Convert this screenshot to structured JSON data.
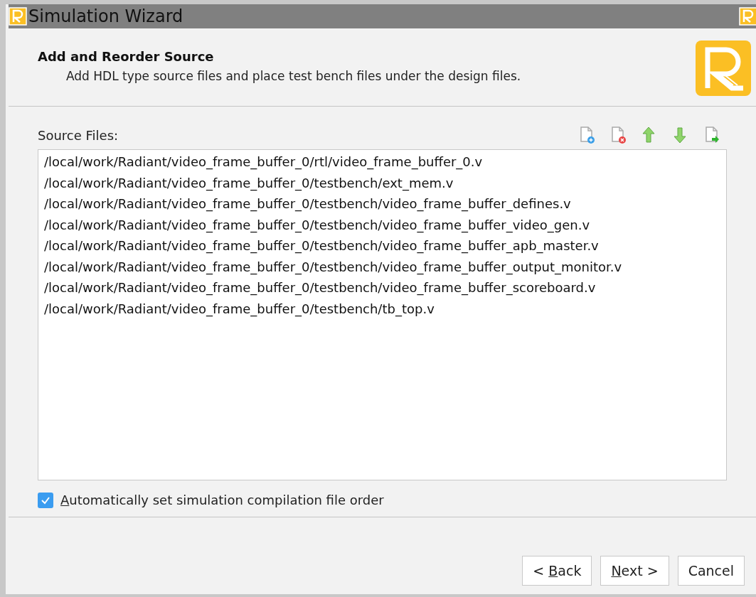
{
  "window": {
    "title": "Simulation Wizard"
  },
  "header": {
    "title": "Add and Reorder Source",
    "subtitle": "Add HDL type source files and place test bench files under the design files."
  },
  "source_files": {
    "label": "Source Files:",
    "toolbar": [
      {
        "kind": "add"
      },
      {
        "kind": "remove"
      },
      {
        "kind": "up"
      },
      {
        "kind": "down"
      },
      {
        "kind": "import"
      }
    ],
    "files": [
      "/local/work/Radiant/video_frame_buffer_0/rtl/video_frame_buffer_0.v",
      "/local/work/Radiant/video_frame_buffer_0/testbench/ext_mem.v",
      "/local/work/Radiant/video_frame_buffer_0/testbench/video_frame_buffer_defines.v",
      "/local/work/Radiant/video_frame_buffer_0/testbench/video_frame_buffer_video_gen.v",
      "/local/work/Radiant/video_frame_buffer_0/testbench/video_frame_buffer_apb_master.v",
      "/local/work/Radiant/video_frame_buffer_0/testbench/video_frame_buffer_output_monitor.v",
      "/local/work/Radiant/video_frame_buffer_0/testbench/video_frame_buffer_scoreboard.v",
      "/local/work/Radiant/video_frame_buffer_0/testbench/tb_top.v"
    ]
  },
  "auto_order": {
    "checked": true,
    "label": {
      "key": "A",
      "after": "utomatically set simulation compilation file order"
    }
  },
  "buttons": [
    {
      "label": {
        "before": "< ",
        "key": "B",
        "after": "ack"
      }
    },
    {
      "label": {
        "key": "N",
        "after": "ext >"
      }
    },
    {
      "label": {
        "before": "Cancel"
      }
    }
  ]
}
